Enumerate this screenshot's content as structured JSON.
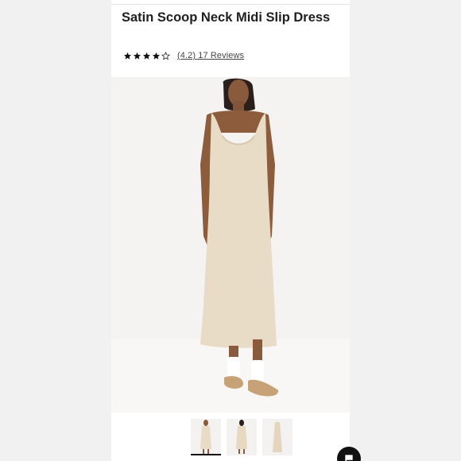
{
  "product": {
    "title": "Satin Scoop Neck Midi Slip Dress",
    "rating_value": 4.2,
    "rating_max": 5,
    "rating_text": "(4.2) 17 Reviews",
    "icons": [
      "star-filled-icon",
      "star-filled-icon",
      "star-filled-icon",
      "star-filled-icon",
      "star-outline-icon"
    ]
  },
  "gallery": {
    "images": [
      "main-product-photo",
      "thumbnail-front",
      "thumbnail-back",
      "thumbnail-flat"
    ],
    "active_index": 0
  },
  "colors": {
    "dress": "#e9dcc7",
    "page_background": "#f1f1f1",
    "photo_background": "#f4f3f1",
    "star": "#111111"
  }
}
